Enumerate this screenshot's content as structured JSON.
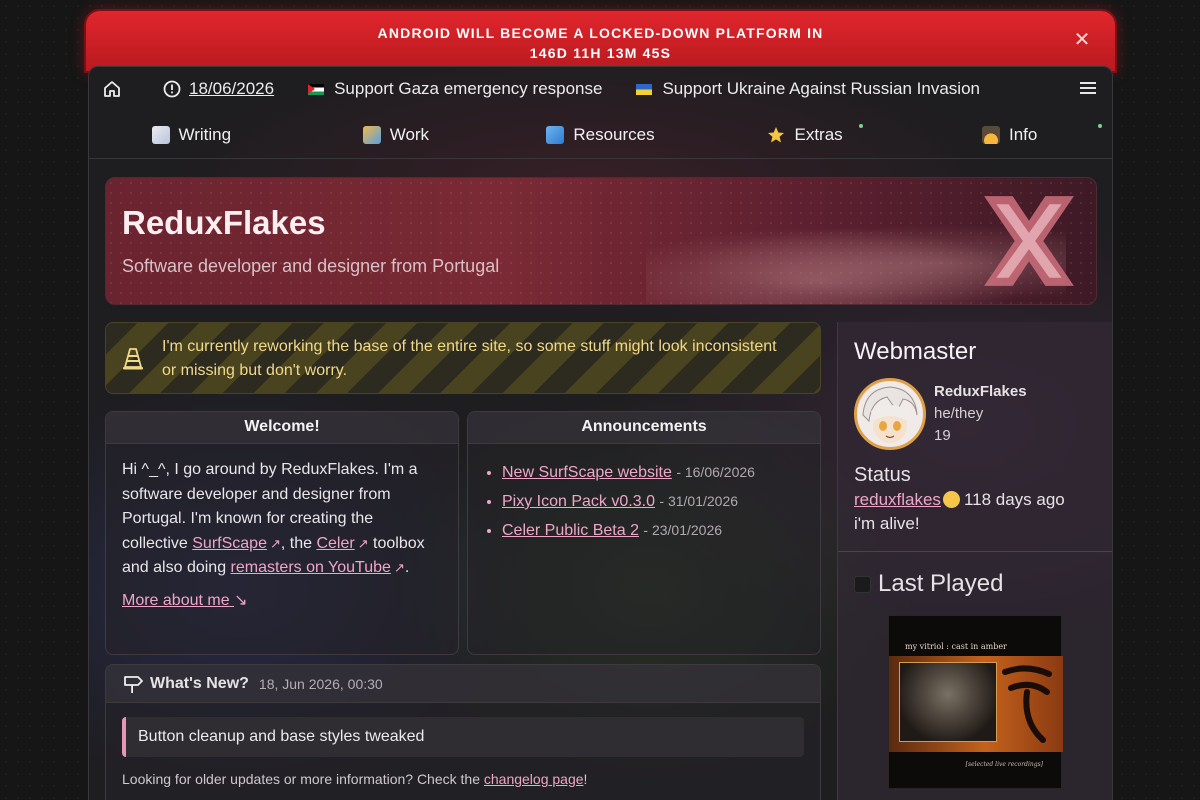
{
  "banner": {
    "line1": "ANDROID WILL BECOME A LOCKED-DOWN PLATFORM IN",
    "line2": "146D 11H 13M 45S",
    "close_glyph": "✕"
  },
  "topnav": {
    "date": "18/06/2026",
    "gaza_label": "Support Gaza emergency response",
    "ukraine_label": "Support Ukraine Against Russian Invasion"
  },
  "secnav": {
    "tabs": [
      {
        "label": "Writing",
        "icon": "writing-icon"
      },
      {
        "label": "Work",
        "icon": "work-icon"
      },
      {
        "label": "Resources",
        "icon": "book-icon"
      },
      {
        "label": "Extras",
        "icon": "star-icon"
      },
      {
        "label": "Info",
        "icon": "info-sunrise-icon"
      }
    ]
  },
  "hero": {
    "title": "ReduxFlakes",
    "subtitle": "Software developer and designer from Portugal"
  },
  "notice": {
    "text": "I'm currently reworking the base of the entire site, so some stuff might look inconsistent or missing but don't worry."
  },
  "welcome": {
    "title": "Welcome!",
    "intro": "Hi ^_^, I go around by ReduxFlakes. I'm a software developer and designer from Portugal. I'm known for creating the collective ",
    "surfscape": "SurfScape",
    "the": ", the ",
    "celer": "Celer",
    "toolbox": " toolbox and also doing ",
    "remasters": "remasters on YouTube",
    "period": ".",
    "more": "More about me",
    "more_arrow": "↘"
  },
  "announcements": {
    "title": "Announcements",
    "items": [
      {
        "label": "New SurfScape website",
        "date": "- 16/06/2026"
      },
      {
        "label": "Pixy Icon Pack v0.3.0",
        "date": "- 31/01/2026"
      },
      {
        "label": "Celer Public Beta 2",
        "date": "- 23/01/2026"
      }
    ]
  },
  "whatsnew": {
    "title": "What's New?",
    "timestamp": "18, Jun 2026, 00:30",
    "entry": "Button cleanup and base styles tweaked",
    "foot_prefix": "Looking for older updates or more information? Check the ",
    "foot_link": "changelog page",
    "foot_suffix": "!"
  },
  "webmaster": {
    "title": "Webmaster",
    "name": "ReduxFlakes",
    "pronouns": "he/they",
    "age": "19",
    "status_title": "Status",
    "status_user": "reduxflakes",
    "status_time": "118 days ago",
    "status_message": "i'm alive!"
  },
  "last_played": {
    "title": "Last Played",
    "album_top": "my vitriol  :  cast in amber",
    "album_bottom": "[selected live recordings]"
  },
  "colors": {
    "banner_red": "#d8232a",
    "link_pink": "#f0a6c8",
    "notice_yellow": "#f1d98a"
  }
}
